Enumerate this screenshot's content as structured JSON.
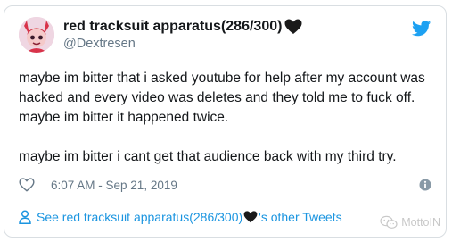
{
  "user": {
    "display_name": "red tracksuit apparatus(286/300)",
    "handle": "@Dextresen"
  },
  "tweet": {
    "paragraph_1": "maybe im bitter that i asked youtube for help after my account was hacked and every video was deletes and they told me to fuck off. maybe im bitter it happened twice.",
    "paragraph_2": "maybe im bitter i cant get that audience back with my third try.",
    "timestamp": "6:07 AM - Sep 21, 2019"
  },
  "footer": {
    "prefix": "See red tracksuit apparatus(286/300)",
    "suffix": "'s other Tweets"
  },
  "watermark": {
    "text": "MottoIN"
  },
  "icons": {
    "header_heart": "black-heart-icon",
    "brand": "twitter-bird-icon",
    "like": "heart-outline-icon",
    "info": "info-icon",
    "footer_person": "person-icon",
    "footer_heart": "black-heart-icon",
    "watermark": "wechat-icon"
  },
  "colors": {
    "link": "#1b95e0",
    "twitter_blue": "#1da1f2",
    "muted": "#657786",
    "text": "#14171a",
    "border": "#d9dee2"
  }
}
